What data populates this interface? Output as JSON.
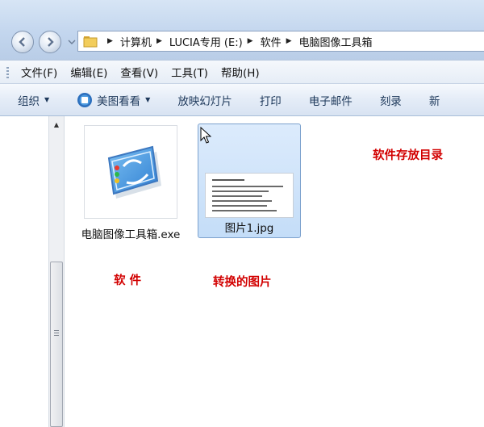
{
  "address": {
    "crumbs": [
      "计算机",
      "LUCIA专用 (E:)",
      "软件",
      "电脑图像工具箱"
    ]
  },
  "menu": {
    "items": [
      "文件(F)",
      "编辑(E)",
      "查看(V)",
      "工具(T)",
      "帮助(H)"
    ]
  },
  "toolbar": {
    "organize": "组织",
    "viewer": "美图看看",
    "slideshow": "放映幻灯片",
    "print": "打印",
    "email": "电子邮件",
    "burn": "刻录",
    "new": "新"
  },
  "files": [
    {
      "name": "电脑图像工具箱.exe",
      "icon": "app-window-icon"
    },
    {
      "name": "图片1.jpg",
      "icon": "document-thumbnail-icon",
      "selected": true
    }
  ],
  "notes": {
    "storage_dir": "软件存放目录",
    "software": "软 件",
    "converted_image": "转换的图片"
  },
  "colors": {
    "note_red": "#d20000",
    "selection": "#cce4fb",
    "toolbar_text": "#1e395b"
  }
}
